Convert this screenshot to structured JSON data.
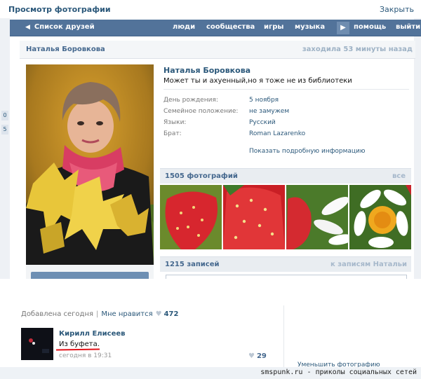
{
  "viewer": {
    "title": "Просмотр фотографии",
    "close_label": "Закрыть"
  },
  "side_marks": [
    "0",
    "5"
  ],
  "nav": {
    "back_label": "Список друзей",
    "items": [
      "люди",
      "сообщества",
      "игры",
      "музыка",
      "помощь",
      "выйти"
    ]
  },
  "profile": {
    "name": "Наталья Боровкова",
    "last_seen": "заходила 53 минуты назад",
    "status": "Может ты и ахуенный,но я тоже не из библиотеки",
    "fields": [
      {
        "label": "День рождения:",
        "value": "5 ноября"
      },
      {
        "label": "Семейное положение:",
        "value": "не замужем"
      },
      {
        "label": "Языки:",
        "value": "Русский"
      },
      {
        "label": "Брат:",
        "value": "Roman Lazarenko"
      }
    ],
    "more_info": "Показать подробную информацию"
  },
  "photos": {
    "count_label": "1505 фотографий",
    "all_label": "все"
  },
  "wall": {
    "count_label": "1215 записей",
    "to_label": "к записям Натальи"
  },
  "photo_meta": {
    "added": "Добавлена сегодня",
    "like_label": "Мне нравится",
    "like_count": "472"
  },
  "comment": {
    "author": "Кирилл Елисеев",
    "text": "Из буфета.",
    "time": "сегодня в 19:31",
    "likes": "29"
  },
  "shrink_label": "Уменьшить фотографию",
  "watermark": "smspunk.ru - приколы социальных сетей",
  "colors": {
    "nav_bg": "#52739a",
    "link": "#2b587a",
    "underline": "#e2131a"
  }
}
